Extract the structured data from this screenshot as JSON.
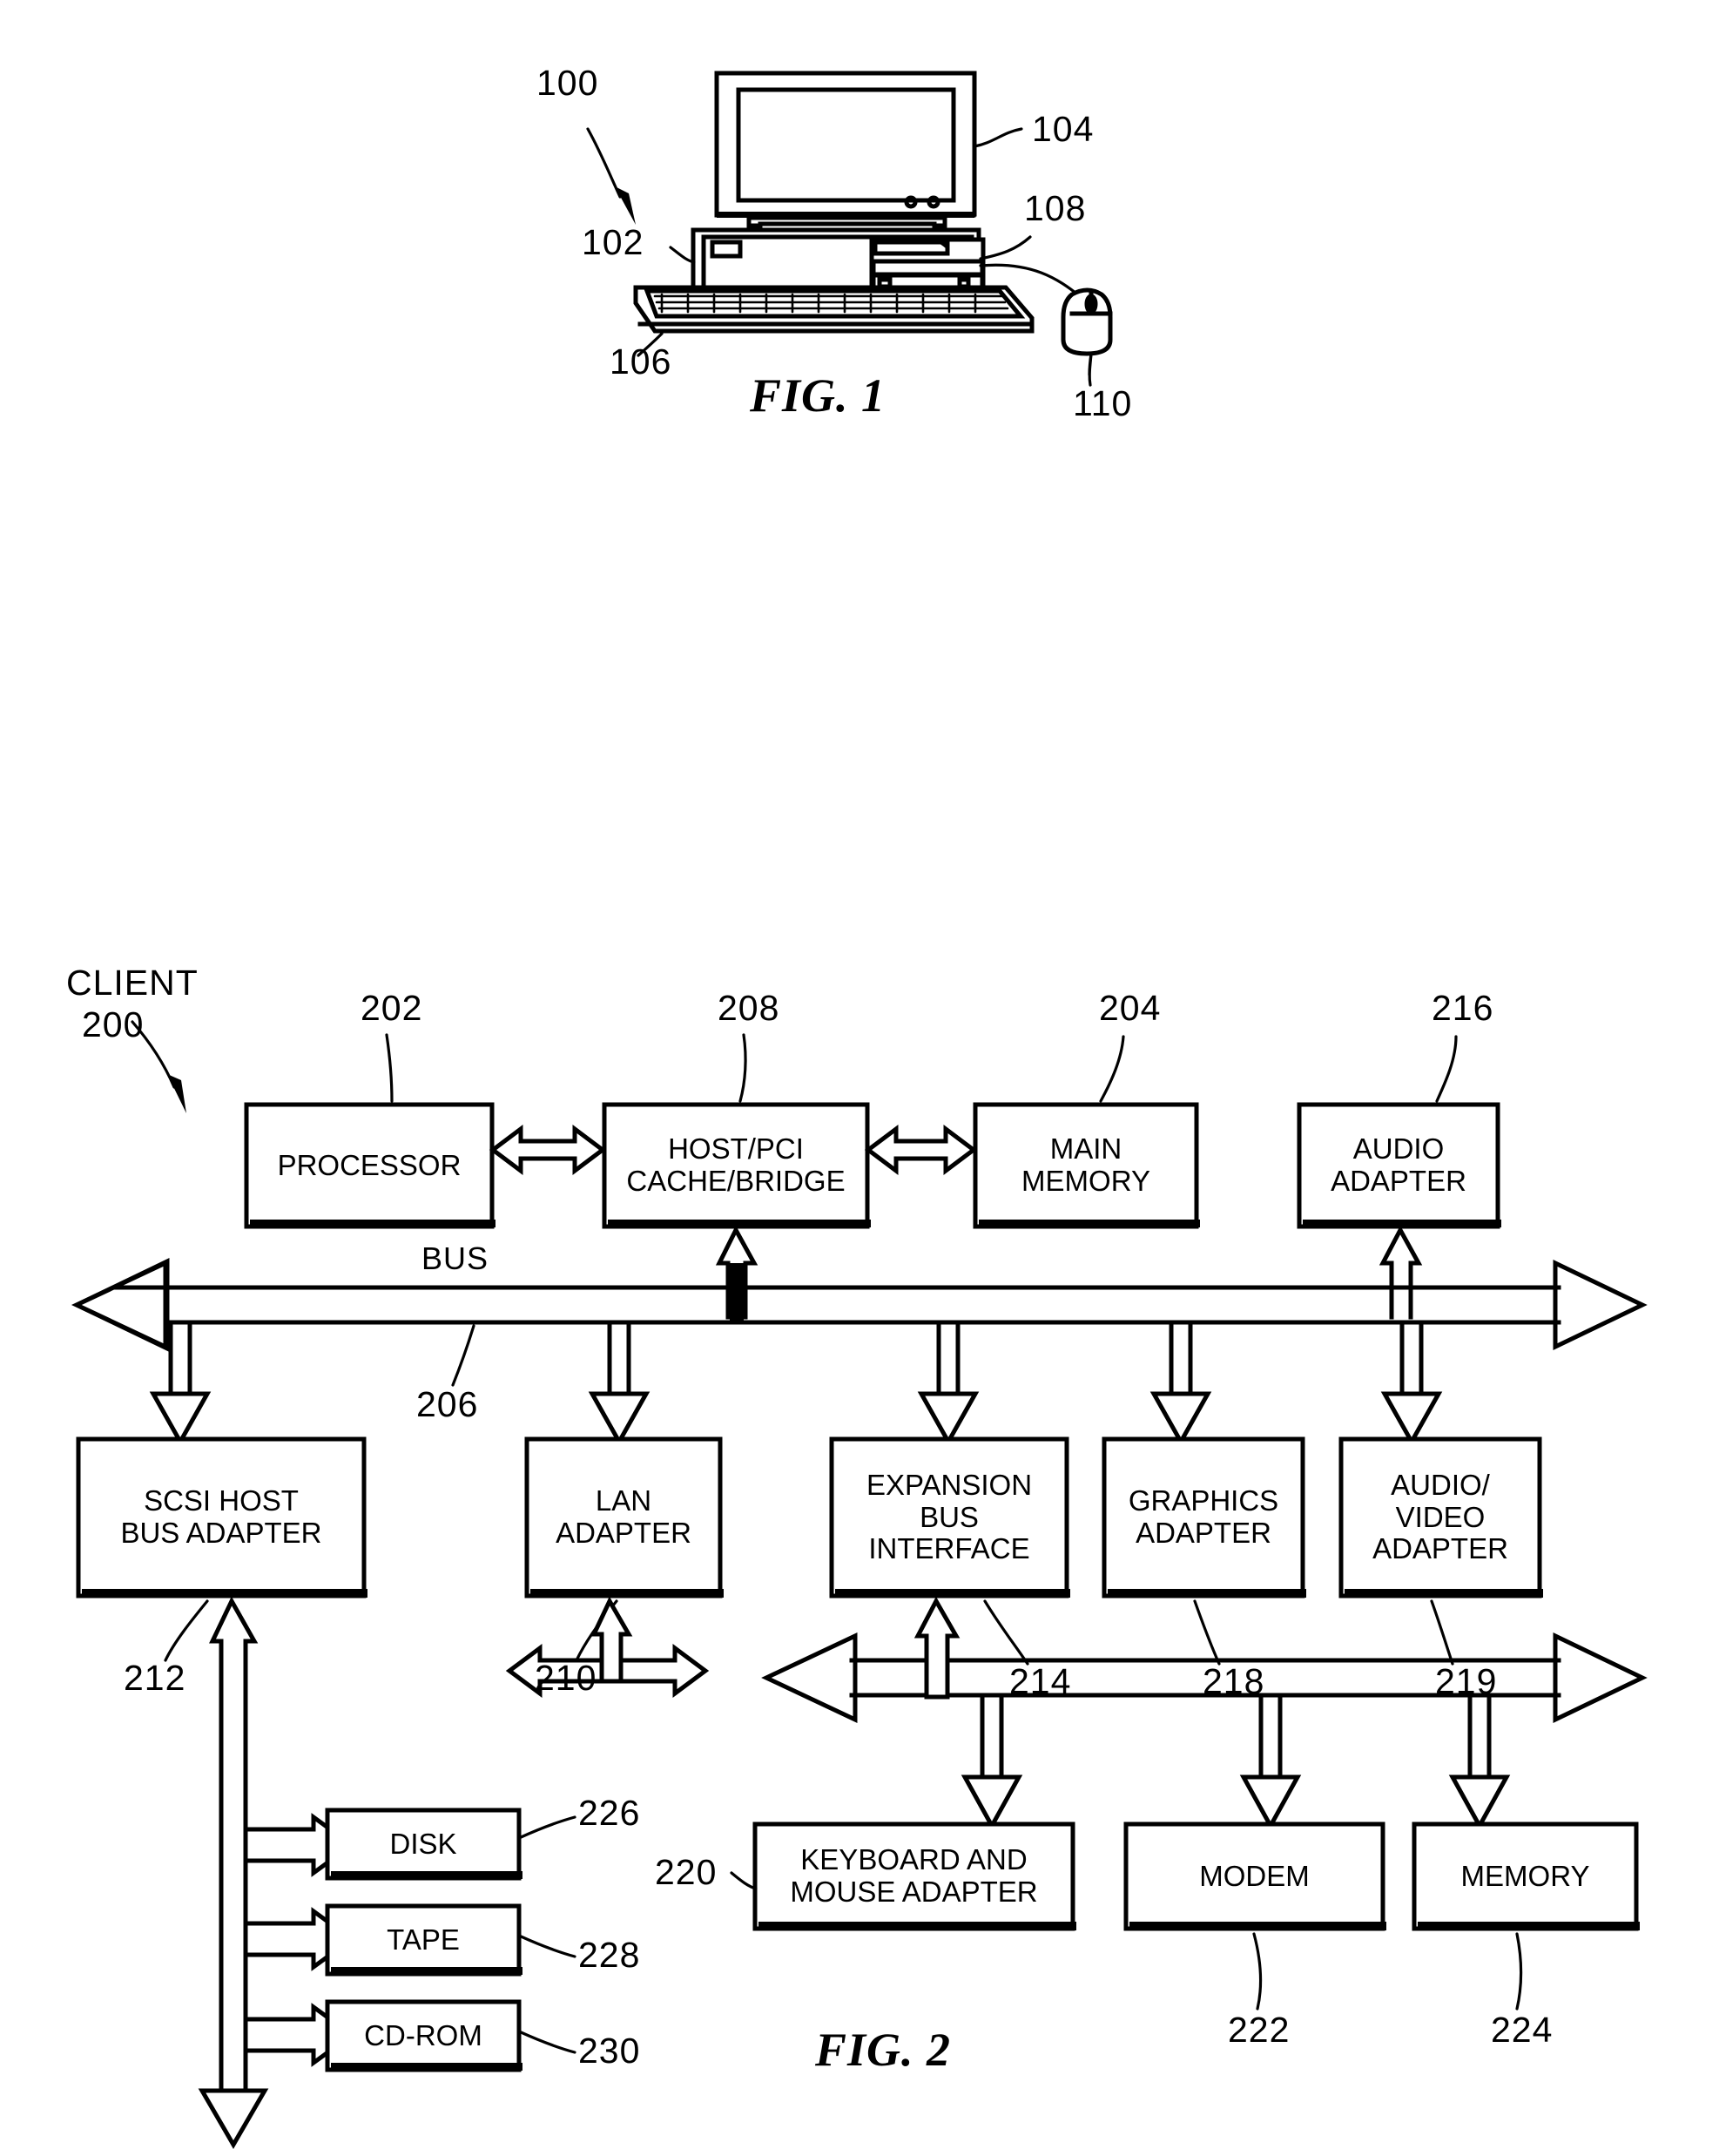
{
  "figures": [
    {
      "id": "fig1",
      "caption": "FIG. 1",
      "title": "Data processing system pictorial",
      "refs": [
        {
          "num": "100",
          "name": "system"
        },
        {
          "num": "104",
          "name": "display-monitor"
        },
        {
          "num": "108",
          "name": "media-drive"
        },
        {
          "num": "102",
          "name": "system-unit"
        },
        {
          "num": "106",
          "name": "keyboard"
        },
        {
          "num": "110",
          "name": "mouse"
        }
      ]
    },
    {
      "id": "fig2",
      "caption": "FIG. 2",
      "client_label_line1": "CLIENT",
      "client_label_line2": "200",
      "bus_label": "BUS",
      "boxes": [
        {
          "id": "processor",
          "lines": [
            "PROCESSOR"
          ],
          "ref": "202"
        },
        {
          "id": "host-pci-bridge",
          "lines": [
            "HOST/PCI",
            "CACHE/BRIDGE"
          ],
          "ref": "208"
        },
        {
          "id": "main-memory",
          "lines": [
            "MAIN",
            "MEMORY"
          ],
          "ref": "204"
        },
        {
          "id": "audio-adapter",
          "lines": [
            "AUDIO",
            "ADAPTER"
          ],
          "ref": "216"
        },
        {
          "id": "scsi-host-bus-adapter",
          "lines": [
            "SCSI HOST",
            "BUS ADAPTER"
          ],
          "ref": "212"
        },
        {
          "id": "lan-adapter",
          "lines": [
            "LAN",
            "ADAPTER"
          ],
          "ref": "210"
        },
        {
          "id": "expansion-bus-interface",
          "lines": [
            "EXPANSION",
            "BUS",
            "INTERFACE"
          ],
          "ref": "214"
        },
        {
          "id": "graphics-adapter",
          "lines": [
            "GRAPHICS",
            "ADAPTER"
          ],
          "ref": "218"
        },
        {
          "id": "audio-video-adapter",
          "lines": [
            "AUDIO/",
            "VIDEO",
            "ADAPTER"
          ],
          "ref": "219"
        },
        {
          "id": "disk",
          "lines": [
            "DISK"
          ],
          "ref": "226"
        },
        {
          "id": "tape",
          "lines": [
            "TAPE"
          ],
          "ref": "228"
        },
        {
          "id": "cd-rom",
          "lines": [
            "CD-ROM"
          ],
          "ref": "230"
        },
        {
          "id": "keyboard-mouse-adapter",
          "lines": [
            "KEYBOARD AND",
            "MOUSE ADAPTER"
          ],
          "ref": "220"
        },
        {
          "id": "modem",
          "lines": [
            "MODEM"
          ],
          "ref": "222"
        },
        {
          "id": "memory",
          "lines": [
            "MEMORY"
          ],
          "ref": "224"
        }
      ],
      "bus_ref": "206"
    }
  ],
  "fig1": {
    "caption": "FIG. 1",
    "ref_100": "100",
    "ref_104": "104",
    "ref_108": "108",
    "ref_102": "102",
    "ref_106": "106",
    "ref_110": "110"
  },
  "fig2": {
    "caption": "FIG. 2",
    "client_line1": "CLIENT",
    "client_line2": "200",
    "bus_label": "BUS",
    "ref_202": "202",
    "ref_208": "208",
    "ref_204": "204",
    "ref_216": "216",
    "ref_206": "206",
    "ref_212": "212",
    "ref_210": "210",
    "ref_214": "214",
    "ref_218": "218",
    "ref_219": "219",
    "ref_226": "226",
    "ref_228": "228",
    "ref_230": "230",
    "ref_220": "220",
    "ref_222": "222",
    "ref_224": "224",
    "box_processor": "PROCESSOR",
    "box_hostpci_l1": "HOST/PCI",
    "box_hostpci_l2": "CACHE/BRIDGE",
    "box_mainmem_l1": "MAIN",
    "box_mainmem_l2": "MEMORY",
    "box_audioad_l1": "AUDIO",
    "box_audioad_l2": "ADAPTER",
    "box_scsi_l1": "SCSI HOST",
    "box_scsi_l2": "BUS ADAPTER",
    "box_lan_l1": "LAN",
    "box_lan_l2": "ADAPTER",
    "box_exp_l1": "EXPANSION",
    "box_exp_l2": "BUS",
    "box_exp_l3": "INTERFACE",
    "box_gfx_l1": "GRAPHICS",
    "box_gfx_l2": "ADAPTER",
    "box_av_l1": "AUDIO/",
    "box_av_l2": "VIDEO",
    "box_av_l3": "ADAPTER",
    "box_disk": "DISK",
    "box_tape": "TAPE",
    "box_cdrom": "CD-ROM",
    "box_kbm_l1": "KEYBOARD AND",
    "box_kbm_l2": "MOUSE ADAPTER",
    "box_modem": "MODEM",
    "box_memory": "MEMORY"
  },
  "colors": {
    "ink": "#000000",
    "paper": "#ffffff"
  }
}
